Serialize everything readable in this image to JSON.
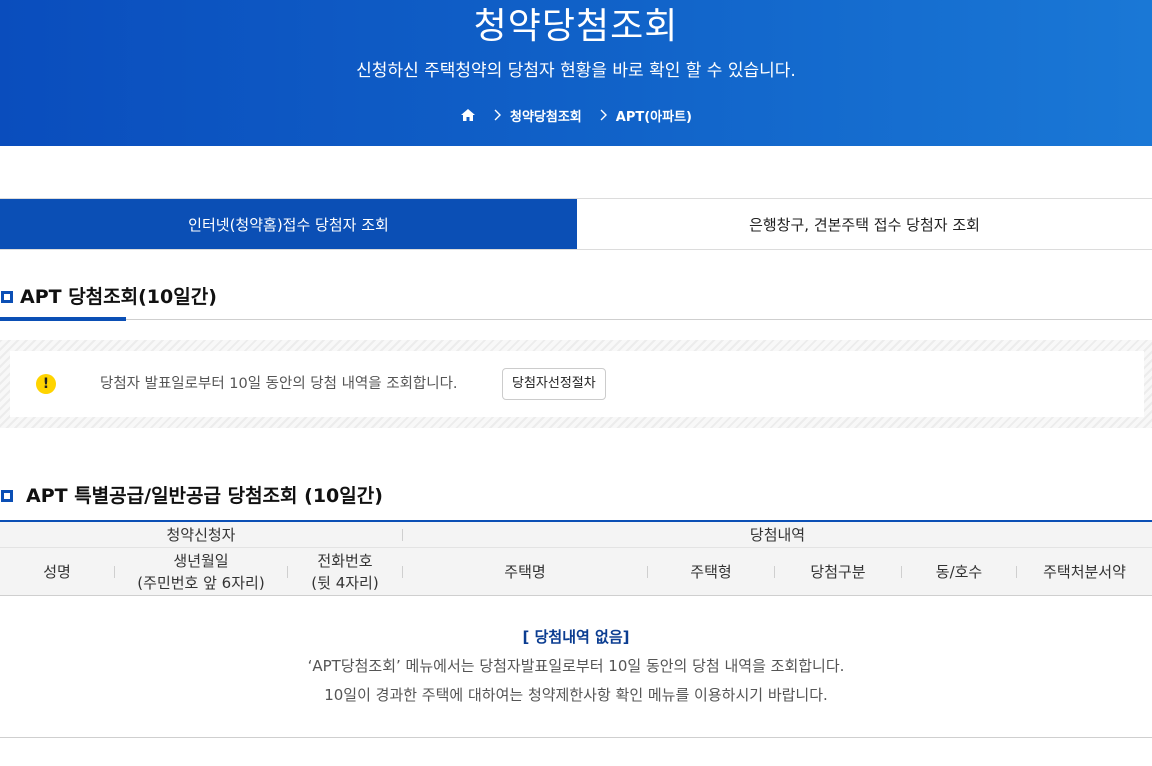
{
  "header": {
    "title": "청약당첨조회",
    "subtitle": "신청하신 주택청약의 당첨자 현황을 바로 확인 할 수 있습니다.",
    "breadcrumb": [
      "청약당첨조회",
      "APT(아파트)"
    ]
  },
  "tabs": [
    {
      "label": "인터넷(청약홈)접수 당첨자 조회",
      "active": true
    },
    {
      "label": "은행창구, 견본주택 접수 당첨자 조회",
      "active": false
    }
  ],
  "section1": {
    "title": "APT 당첨조회(10일간)",
    "notice_text": "당첨자 발표일로부터 10일 동안의 당첨 내역을 조회합니다.",
    "notice_button": "당첨자선정절차"
  },
  "section2": {
    "title": "APT 특별공급/일반공급 당첨조회 (10일간)"
  },
  "table": {
    "group_headers": [
      "청약신청자",
      "당첨내역"
    ],
    "columns": [
      {
        "line1": "성명",
        "line2": ""
      },
      {
        "line1": "생년월일",
        "line2": "(주민번호 앞 6자리)"
      },
      {
        "line1": "전화번호",
        "line2": "(뒷 4자리)"
      },
      {
        "line1": "주택명",
        "line2": ""
      },
      {
        "line1": "주택형",
        "line2": ""
      },
      {
        "line1": "당첨구분",
        "line2": ""
      },
      {
        "line1": "동/호수",
        "line2": ""
      },
      {
        "line1": "주택처분서약",
        "line2": ""
      }
    ],
    "empty_title": "[ 당첨내역 없음]",
    "empty_lines": [
      "‘APT당첨조회’ 메뉴에서는 당첨자발표일로부터 10일 동안의 당첨 내역을 조회합니다.",
      "10일이 경과한 주택에 대하여는 청약제한사항 확인 메뉴를 이용하시기 바랍니다."
    ]
  },
  "colors": {
    "primary": "#0b4fb5",
    "warning": "#ffd400"
  }
}
